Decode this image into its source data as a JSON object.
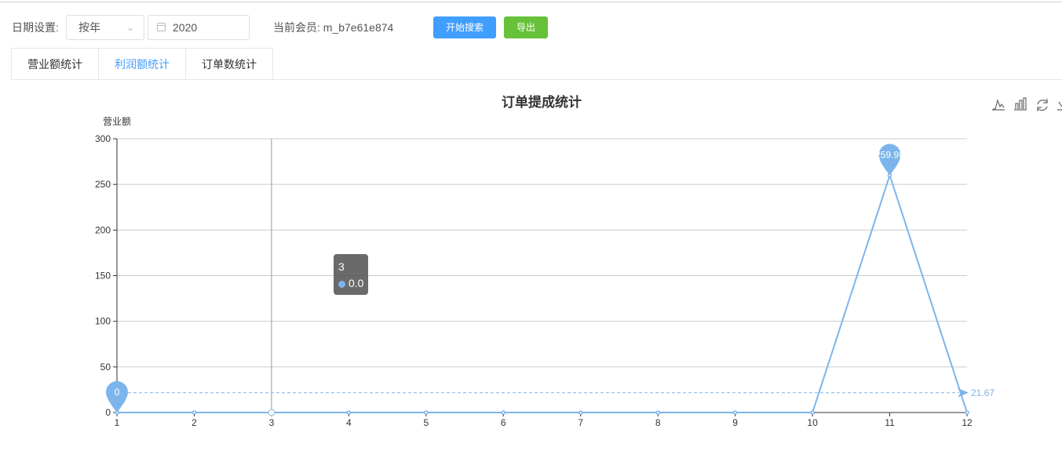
{
  "toolbar": {
    "date_label": "日期设置:",
    "period_select_value": "按年",
    "year_value": "2020",
    "member_label": "当前会员: m_b7e61e874",
    "search_button": "开始搜索",
    "export_button": "导出"
  },
  "tabs": [
    {
      "label": "营业额统计",
      "active": false
    },
    {
      "label": "利润额统计",
      "active": true
    },
    {
      "label": "订单数统计",
      "active": false
    }
  ],
  "tooltip": {
    "title": "3",
    "value": "0.0"
  },
  "toolbox_icons": [
    "line-chart-icon",
    "bar-chart-icon",
    "refresh-icon",
    "download-icon"
  ],
  "colors": {
    "series": "#7cb5ec",
    "primary": "#409eff",
    "success": "#67c23a"
  },
  "chart_data": {
    "type": "line",
    "title": "订单提成统计",
    "ylabel": "营业额",
    "xlabel": "",
    "categories": [
      "1",
      "2",
      "3",
      "4",
      "5",
      "6",
      "7",
      "8",
      "9",
      "10",
      "11",
      "12"
    ],
    "series": [
      {
        "values": [
          0,
          0,
          0,
          0,
          0,
          0,
          0,
          0,
          0,
          0,
          259.98,
          0
        ]
      }
    ],
    "ylim": [
      0,
      300
    ],
    "yticks": [
      0,
      50,
      100,
      150,
      200,
      250,
      300
    ],
    "mark_points": [
      {
        "label": "259.98",
        "category": "11",
        "value": 259.98
      },
      {
        "label": "0",
        "category": "1",
        "value": 0
      }
    ],
    "mark_line": {
      "label": "21.67",
      "value": 21.67
    },
    "grid": true
  }
}
